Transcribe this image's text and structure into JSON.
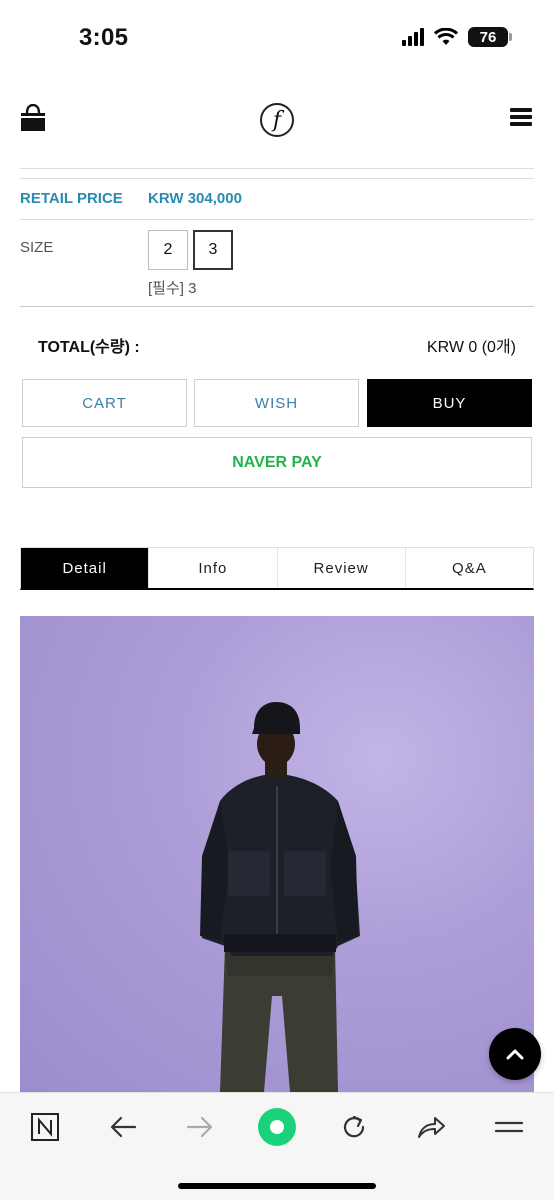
{
  "status_bar": {
    "time": "3:05",
    "battery": "76"
  },
  "header": {
    "logo_glyph": "f"
  },
  "product": {
    "retail_label": "RETAIL PRICE",
    "retail_value": "KRW 304,000",
    "size_label": "SIZE",
    "sizes": [
      "2",
      "3"
    ],
    "selected_size": "3",
    "size_note": "[필수] 3"
  },
  "total": {
    "label": "TOTAL(수량) :",
    "value": "KRW 0 (0개)"
  },
  "buttons": {
    "cart": "CART",
    "wish": "WISH",
    "buy": "BUY",
    "naver": "NAVER PAY"
  },
  "tabs": [
    {
      "label": "Detail",
      "active": true
    },
    {
      "label": "Info",
      "active": false
    },
    {
      "label": "Review",
      "active": false
    },
    {
      "label": "Q&A",
      "active": false
    }
  ],
  "colors": {
    "accent_blue": "#2a8bb0",
    "naver_green": "#24b34a",
    "photo_bg": "#b0a2dc",
    "home_icon_green": "#19d27a"
  },
  "bottom_bar": {
    "icons": [
      "naver-n-icon",
      "back-arrow-icon",
      "forward-arrow-icon",
      "home-green-icon",
      "refresh-icon",
      "share-icon",
      "menu-icon"
    ]
  }
}
